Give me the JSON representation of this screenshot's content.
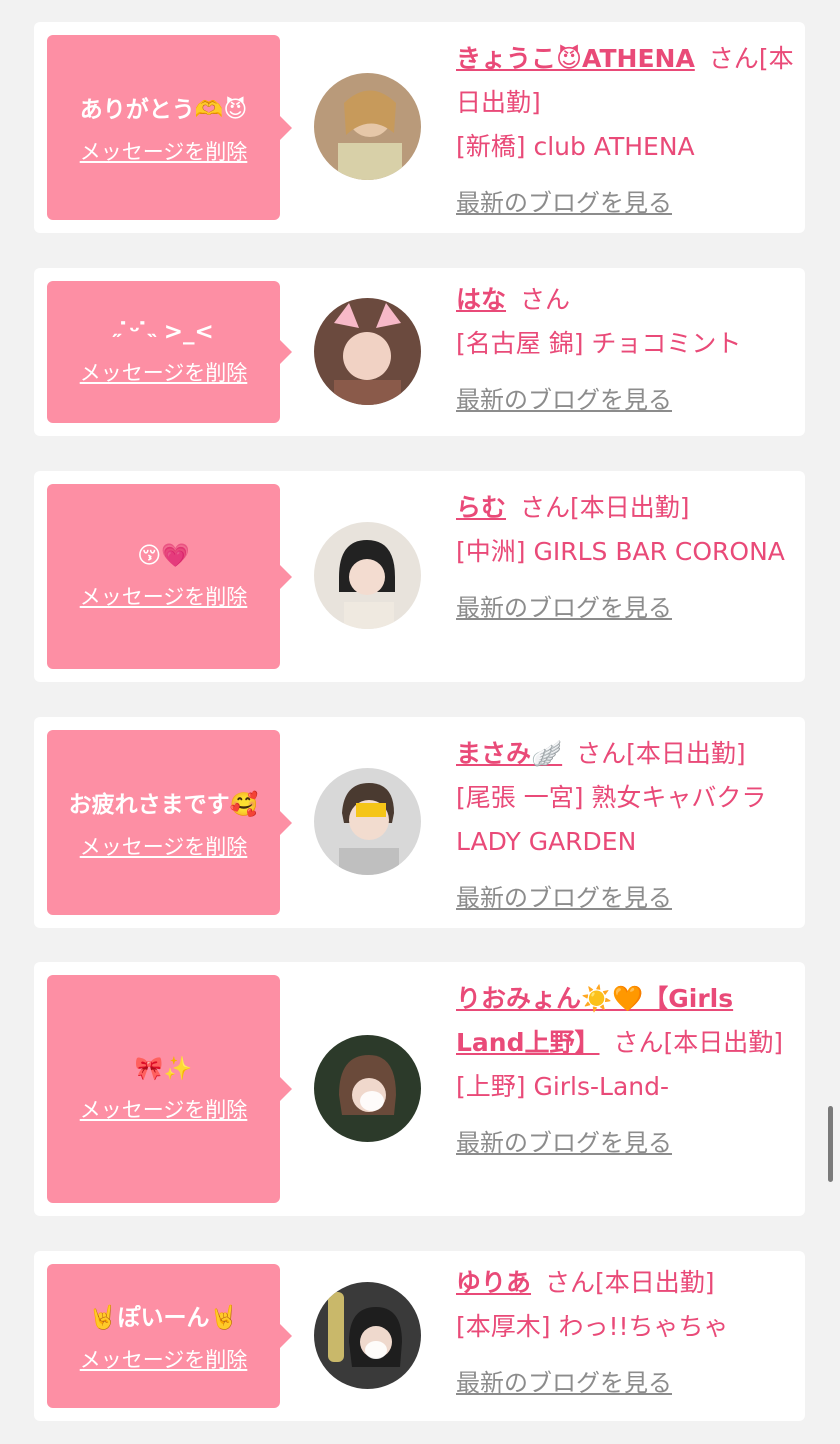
{
  "cards": [
    {
      "message": "ありがとう🫶😈",
      "delete_label": "メッセージを削除",
      "name": "きょうこ😈ATHENA",
      "honorific": "さん",
      "status": "[本日出勤]",
      "shop": "[新橋] club ATHENA",
      "blog_label": "最新のブログを見る"
    },
    {
      "message": "˶ ̇ᵕ ̇˵ >_<",
      "delete_label": "メッセージを削除",
      "name": "はな",
      "honorific": "さん",
      "status": "",
      "shop": "[名古屋 錦] チョコミント",
      "blog_label": "最新のブログを見る"
    },
    {
      "message": "😚💗",
      "delete_label": "メッセージを削除",
      "name": "らむ",
      "honorific": "さん",
      "status": "[本日出勤]",
      "shop": "[中洲] GIRLS BAR CORONA",
      "blog_label": "最新のブログを見る"
    },
    {
      "message": "お疲れさまです🥰",
      "delete_label": "メッセージを削除",
      "name": "まさみ🪽",
      "honorific": "さん",
      "status": "[本日出勤]",
      "shop": "[尾張 一宮] 熟女キャバクラ LADY GARDEN",
      "blog_label": "最新のブログを見る"
    },
    {
      "message": "🎀✨",
      "delete_label": "メッセージを削除",
      "name": "りおみょん☀️🧡【Girls Land上野】",
      "honorific": "さん",
      "status": "[本日出勤]",
      "shop": "[上野] Girls-Land-",
      "blog_label": "最新のブログを見る"
    },
    {
      "message": "🤘ぽいーん🤘",
      "delete_label": "メッセージを削除",
      "name": "ゆりあ",
      "honorific": "さん",
      "status": "[本日出勤]",
      "shop": "[本厚木] わっ!!ちゃちゃ",
      "blog_label": "最新のブログを見る"
    }
  ],
  "colors": {
    "bubble": "#fd8fa4",
    "accent_text": "#e94a78",
    "link_gray": "#8c8c8c",
    "page_bg": "#f2f2f2"
  }
}
